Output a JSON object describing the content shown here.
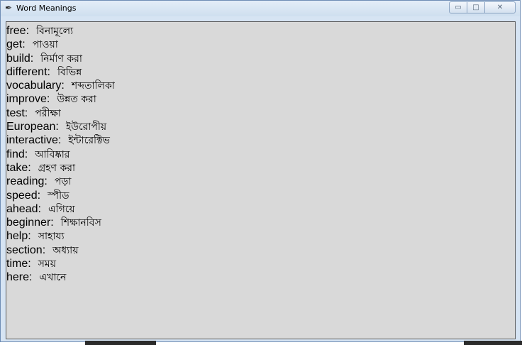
{
  "window": {
    "title": "Word Meanings",
    "icon": "feather-icon",
    "controls": {
      "minimize": "▭",
      "maximize": "□",
      "close": "✕"
    }
  },
  "entries": [
    {
      "word": "free:",
      "meaning": "বিনামূল্যে"
    },
    {
      "word": "get:",
      "meaning": "পাওয়া"
    },
    {
      "word": "build:",
      "meaning": "নির্মাণ করা"
    },
    {
      "word": "different:",
      "meaning": "বিভিন্ন"
    },
    {
      "word": "vocabulary:",
      "meaning": "শব্দতালিকা"
    },
    {
      "word": "improve:",
      "meaning": "উন্নত করা"
    },
    {
      "word": "test:",
      "meaning": "পরীক্ষা"
    },
    {
      "word": "European:",
      "meaning": "ইউরোপীয়"
    },
    {
      "word": "interactive:",
      "meaning": "ইন্টারেক্টিভ"
    },
    {
      "word": "find:",
      "meaning": "আবিষ্কার"
    },
    {
      "word": "take:",
      "meaning": "গ্রহণ করা"
    },
    {
      "word": "reading:",
      "meaning": "পড়া"
    },
    {
      "word": "speed:",
      "meaning": "স্পীড"
    },
    {
      "word": "ahead:",
      "meaning": "এগিয়ে"
    },
    {
      "word": "beginner:",
      "meaning": "শিক্ষানবিস"
    },
    {
      "word": "help:",
      "meaning": "সাহায্য"
    },
    {
      "word": "section:",
      "meaning": "অধ্যায়"
    },
    {
      "word": "time:",
      "meaning": "সময়"
    },
    {
      "word": "here:",
      "meaning": "এখানে"
    }
  ]
}
